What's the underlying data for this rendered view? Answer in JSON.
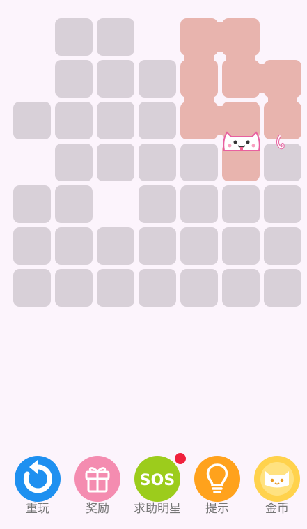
{
  "game": {
    "cell_color": "#d8d0d8",
    "path_color": "#e8b4ae",
    "background": "#fcf4fc",
    "grid": [
      [
        0,
        1,
        1,
        0,
        1,
        1,
        0
      ],
      [
        0,
        1,
        1,
        1,
        1,
        1,
        1
      ],
      [
        1,
        1,
        1,
        1,
        1,
        1,
        1
      ],
      [
        0,
        1,
        1,
        1,
        1,
        1,
        1
      ],
      [
        1,
        1,
        0,
        1,
        1,
        1,
        1
      ],
      [
        1,
        1,
        1,
        1,
        1,
        1,
        1
      ],
      [
        1,
        1,
        1,
        1,
        1,
        1,
        1
      ]
    ],
    "visited": [
      [
        0,
        4
      ],
      [
        0,
        5
      ],
      [
        1,
        4
      ],
      [
        1,
        5
      ],
      [
        1,
        6
      ],
      [
        2,
        4
      ],
      [
        2,
        5
      ],
      [
        2,
        6
      ],
      [
        3,
        5
      ]
    ],
    "path": [
      [
        3,
        5
      ],
      [
        2,
        5
      ],
      [
        2,
        4
      ],
      [
        1,
        4
      ],
      [
        0,
        4
      ],
      [
        0,
        5
      ],
      [
        1,
        5
      ],
      [
        1,
        6
      ],
      [
        2,
        6
      ]
    ],
    "cat_position": [
      3,
      5
    ]
  },
  "toolbar": {
    "buttons": [
      {
        "label": "重玩",
        "icon": "restart-icon",
        "color": "#1e90f0"
      },
      {
        "label": "奖励",
        "icon": "gift-icon",
        "color": "#f48cb0"
      },
      {
        "label": "求助明星",
        "icon": "sos-icon",
        "color": "#9ccc1c",
        "badge_color": "#f0203c"
      },
      {
        "label": "提示",
        "icon": "lightbulb-icon",
        "color": "#ffa21c"
      },
      {
        "label": "金币",
        "icon": "coin-cat-icon",
        "color": "#ffd24c"
      }
    ]
  }
}
